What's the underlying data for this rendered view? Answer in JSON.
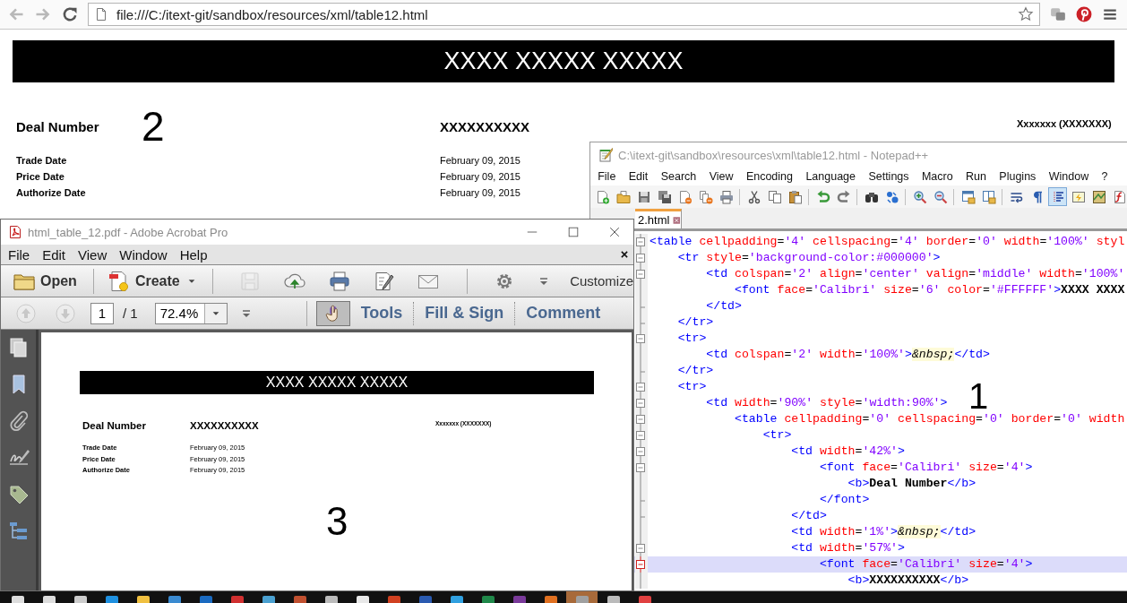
{
  "browser": {
    "nav": [
      {
        "kind": "back",
        "disabled": true
      },
      {
        "kind": "forward",
        "disabled": true
      },
      {
        "kind": "reload",
        "disabled": false
      }
    ],
    "url": "file:///C:/itext-git/sandbox/resources/xml/table12.html",
    "extras": [
      {
        "kind": "extension"
      },
      {
        "kind": "pin"
      },
      {
        "kind": "menu"
      }
    ],
    "page": {
      "banner": "XXXX XXXXX XXXXX",
      "deal_label": "Deal Number",
      "annotation": "2",
      "deal_value": "XXXXXXXXXX",
      "right_text": "Xxxxxxx (XXXXXXX)",
      "dates": [
        {
          "label": "Trade Date",
          "value": "February 09, 2015"
        },
        {
          "label": "Price Date",
          "value": "February 09, 2015"
        },
        {
          "label": "Authorize Date",
          "value": "February 09, 2015"
        }
      ]
    }
  },
  "notepad": {
    "title": "C:\\itext-git\\sandbox\\resources\\xml\\table12.html - Notepad++",
    "menu": [
      "File",
      "Edit",
      "Search",
      "View",
      "Encoding",
      "Language",
      "Settings",
      "Macro",
      "Run",
      "Plugins",
      "Window",
      "?"
    ],
    "toolbar": [
      {
        "kind": "new",
        "selected": false
      },
      {
        "kind": "open",
        "selected": false
      },
      {
        "kind": "save",
        "selected": false
      },
      {
        "kind": "saveall",
        "selected": false
      },
      {
        "kind": "close",
        "selected": false
      },
      {
        "kind": "closeall",
        "selected": false
      },
      {
        "kind": "print",
        "selected": false
      },
      {
        "kind": "separator"
      },
      {
        "kind": "cut",
        "selected": false
      },
      {
        "kind": "copy",
        "selected": false
      },
      {
        "kind": "paste",
        "selected": false
      },
      {
        "kind": "separator"
      },
      {
        "kind": "undo",
        "selected": false
      },
      {
        "kind": "redo",
        "selected": false
      },
      {
        "kind": "separator"
      },
      {
        "kind": "find",
        "selected": false
      },
      {
        "kind": "replace",
        "selected": false
      },
      {
        "kind": "separator"
      },
      {
        "kind": "zoomin",
        "selected": false
      },
      {
        "kind": "zoomout",
        "selected": false
      },
      {
        "kind": "separator"
      },
      {
        "kind": "syncv",
        "selected": false
      },
      {
        "kind": "synch",
        "selected": false
      },
      {
        "kind": "separator"
      },
      {
        "kind": "wrap",
        "selected": false
      },
      {
        "kind": "allchars",
        "selected": false
      },
      {
        "kind": "indent",
        "selected": true
      },
      {
        "kind": "udl",
        "selected": false
      },
      {
        "kind": "docmap",
        "selected": false
      },
      {
        "kind": "funclist",
        "selected": false
      }
    ],
    "tab": {
      "label": "2.html"
    },
    "lines": [
      {
        "text": "<table cellpadding='4' cellspacing='4' border='0' width='100%' styl",
        "kind": "open",
        "selected": false
      },
      {
        "text": "    <tr style='background-color:#000000'>",
        "kind": "open",
        "selected": false
      },
      {
        "text": "        <td colspan='2' align='center' valign='middle' width='100%'",
        "kind": "open",
        "selected": false
      },
      {
        "text": "            <font face='Calibri' size='6' color='#FFFFFF'>XXXX XXXX",
        "kind": "line",
        "selected": false
      },
      {
        "text": "        </td>",
        "kind": "end",
        "selected": false
      },
      {
        "text": "    </tr>",
        "kind": "end",
        "selected": false
      },
      {
        "text": "    <tr>",
        "kind": "open",
        "selected": false
      },
      {
        "text": "        <td colspan='2' width='100%'>&nbsp;</td>",
        "kind": "line",
        "selected": false
      },
      {
        "text": "    </tr>",
        "kind": "end",
        "selected": false
      },
      {
        "text": "    <tr>",
        "kind": "open",
        "selected": false
      },
      {
        "text": "        <td width='90%' style='width:90%'>",
        "kind": "open",
        "selected": false
      },
      {
        "text": "            <table cellpadding='0' cellspacing='0' border='0' width",
        "kind": "open",
        "selected": false
      },
      {
        "text": "                <tr>",
        "kind": "open",
        "selected": false
      },
      {
        "text": "                    <td width='42%'>",
        "kind": "open",
        "selected": false
      },
      {
        "text": "                        <font face='Calibri' size='4'>",
        "kind": "open",
        "selected": false
      },
      {
        "text": "                            <b>Deal Number</b>",
        "kind": "line",
        "selected": false
      },
      {
        "text": "                        </font>",
        "kind": "end",
        "selected": false
      },
      {
        "text": "                    </td>",
        "kind": "end",
        "selected": false
      },
      {
        "text": "                    <td width='1%'>&nbsp;</td>",
        "kind": "line",
        "selected": false
      },
      {
        "text": "                    <td width='57%'>",
        "kind": "open",
        "selected": false
      },
      {
        "text": "                        <font face='Calibri' size='4'>",
        "kind": "open",
        "selected": true
      },
      {
        "text": "                            <b>XXXXXXXXXX</b>",
        "kind": "line",
        "selected": false
      }
    ],
    "annotation": "1"
  },
  "acrobat": {
    "title": "html_table_12.pdf - Adobe Acrobat Pro",
    "menu": [
      "File",
      "Edit",
      "View",
      "Window",
      "Help"
    ],
    "toolbar": [
      {
        "kind": "open",
        "label": "Open"
      },
      {
        "kind": "separator"
      },
      {
        "kind": "create",
        "label": "Create"
      },
      {
        "kind": "separator"
      },
      {
        "kind": "save",
        "disabled": true
      },
      {
        "kind": "upload",
        "disabled": false
      },
      {
        "kind": "print",
        "disabled": false
      },
      {
        "kind": "edit",
        "disabled": false
      },
      {
        "kind": "mail",
        "disabled": false
      },
      {
        "kind": "separator"
      },
      {
        "kind": "gear",
        "disabled": false
      },
      {
        "kind": "more",
        "disabled": false
      },
      {
        "kind": "text",
        "label": "Customize"
      }
    ],
    "navbar": [
      {
        "kind": "prev",
        "disabled": true
      },
      {
        "kind": "next",
        "disabled": true
      },
      {
        "kind": "page",
        "value": "1",
        "total": "/ 1"
      },
      {
        "kind": "zoom",
        "value": "72.4%"
      },
      {
        "kind": "more"
      },
      {
        "kind": "separator"
      },
      {
        "kind": "hand",
        "selected": true
      },
      {
        "kind": "pane",
        "label": "Tools"
      },
      {
        "kind": "dots"
      },
      {
        "kind": "pane",
        "label": "Fill & Sign"
      },
      {
        "kind": "dots"
      },
      {
        "kind": "pane",
        "label": "Comment"
      }
    ],
    "sidebar": [
      {
        "kind": "pages"
      },
      {
        "kind": "bookmark"
      },
      {
        "kind": "attachment"
      },
      {
        "kind": "signature"
      },
      {
        "kind": "tag"
      },
      {
        "kind": "tree"
      }
    ],
    "page": {
      "banner": "XXXX XXXXX XXXXX",
      "deal_label": "Deal Number",
      "deal_value": "XXXXXXXXXX",
      "right_text": "Xxxxxxx (XXXXXXX)",
      "dates": [
        {
          "label": "Trade Date",
          "value": "February 09, 2015"
        },
        {
          "label": "Price Date",
          "value": "February 09, 2015"
        },
        {
          "label": "Authorize Date",
          "value": "February 09, 2015"
        }
      ],
      "annotation": "3"
    }
  },
  "taskbar": {
    "apps": [
      {
        "selected": false
      },
      {
        "selected": false
      },
      {
        "selected": false
      },
      {
        "selected": false
      },
      {
        "selected": false
      },
      {
        "selected": false
      },
      {
        "selected": false
      },
      {
        "selected": false
      },
      {
        "selected": false
      },
      {
        "selected": false
      },
      {
        "selected": false
      },
      {
        "selected": false
      },
      {
        "selected": false
      },
      {
        "selected": false
      },
      {
        "selected": false
      },
      {
        "selected": false
      },
      {
        "selected": false
      },
      {
        "selected": false
      },
      {
        "selected": true
      },
      {
        "selected": false
      },
      {
        "selected": false
      }
    ]
  }
}
